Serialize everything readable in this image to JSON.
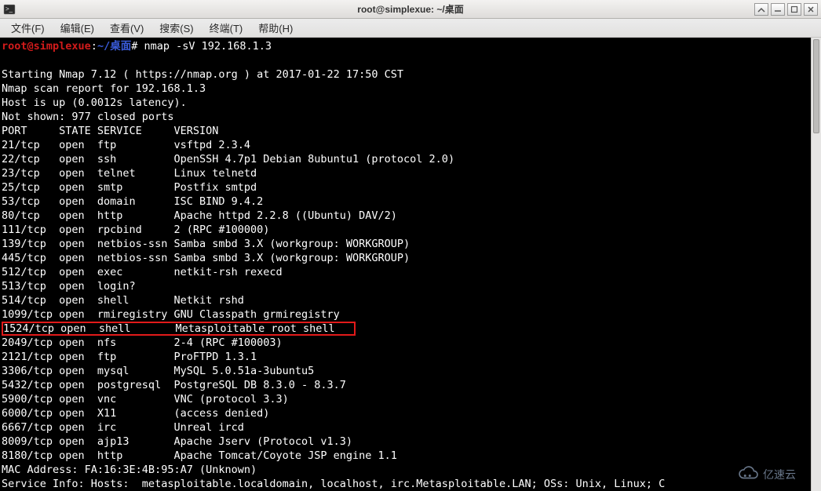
{
  "window": {
    "title": "root@simplexue: ~/桌面"
  },
  "menubar": {
    "items": [
      "文件(F)",
      "编辑(E)",
      "查看(V)",
      "搜索(S)",
      "终端(T)",
      "帮助(H)"
    ]
  },
  "prompt": {
    "user_host": "root@simplexue",
    "colon": ":",
    "path": "~/桌面",
    "hash": "#",
    "command": "nmap -sV 192.168.1.3"
  },
  "output": {
    "blank0": " ",
    "header": "Starting Nmap 7.12 ( https://nmap.org ) at 2017-01-22 17:50 CST",
    "report": "Nmap scan report for 192.168.1.3",
    "hostup": "Host is up (0.0012s latency).",
    "notshown": "Not shown: 977 closed ports",
    "cols": "PORT     STATE SERVICE     VERSION",
    "r21": "21/tcp   open  ftp         vsftpd 2.3.4",
    "r22": "22/tcp   open  ssh         OpenSSH 4.7p1 Debian 8ubuntu1 (protocol 2.0)",
    "r23": "23/tcp   open  telnet      Linux telnetd",
    "r25": "25/tcp   open  smtp        Postfix smtpd",
    "r53": "53/tcp   open  domain      ISC BIND 9.4.2",
    "r80": "80/tcp   open  http        Apache httpd 2.2.8 ((Ubuntu) DAV/2)",
    "r111": "111/tcp  open  rpcbind     2 (RPC #100000)",
    "r139": "139/tcp  open  netbios-ssn Samba smbd 3.X (workgroup: WORKGROUP)",
    "r445": "445/tcp  open  netbios-ssn Samba smbd 3.X (workgroup: WORKGROUP)",
    "r512": "512/tcp  open  exec        netkit-rsh rexecd",
    "r513": "513/tcp  open  login?",
    "r514": "514/tcp  open  shell       Netkit rshd",
    "r1099": "1099/tcp open  rmiregistry GNU Classpath grmiregistry",
    "r1524": "1524/tcp open  shell       Metasploitable root shell   ",
    "r2049": "2049/tcp open  nfs         2-4 (RPC #100003)",
    "r2121": "2121/tcp open  ftp         ProFTPD 1.3.1",
    "r3306": "3306/tcp open  mysql       MySQL 5.0.51a-3ubuntu5",
    "r5432": "5432/tcp open  postgresql  PostgreSQL DB 8.3.0 - 8.3.7",
    "r5900": "5900/tcp open  vnc         VNC (protocol 3.3)",
    "r6000": "6000/tcp open  X11         (access denied)",
    "r6667": "6667/tcp open  irc         Unreal ircd",
    "r8009": "8009/tcp open  ajp13       Apache Jserv (Protocol v1.3)",
    "r8180": "8180/tcp open  http        Apache Tomcat/Coyote JSP engine 1.1",
    "mac": "MAC Address: FA:16:3E:4B:95:A7 (Unknown)",
    "svc": "Service Info: Hosts:  metasploitable.localdomain, localhost, irc.Metasploitable.LAN; OSs: Unix, Linux; C"
  },
  "watermark": {
    "text": "亿速云"
  }
}
